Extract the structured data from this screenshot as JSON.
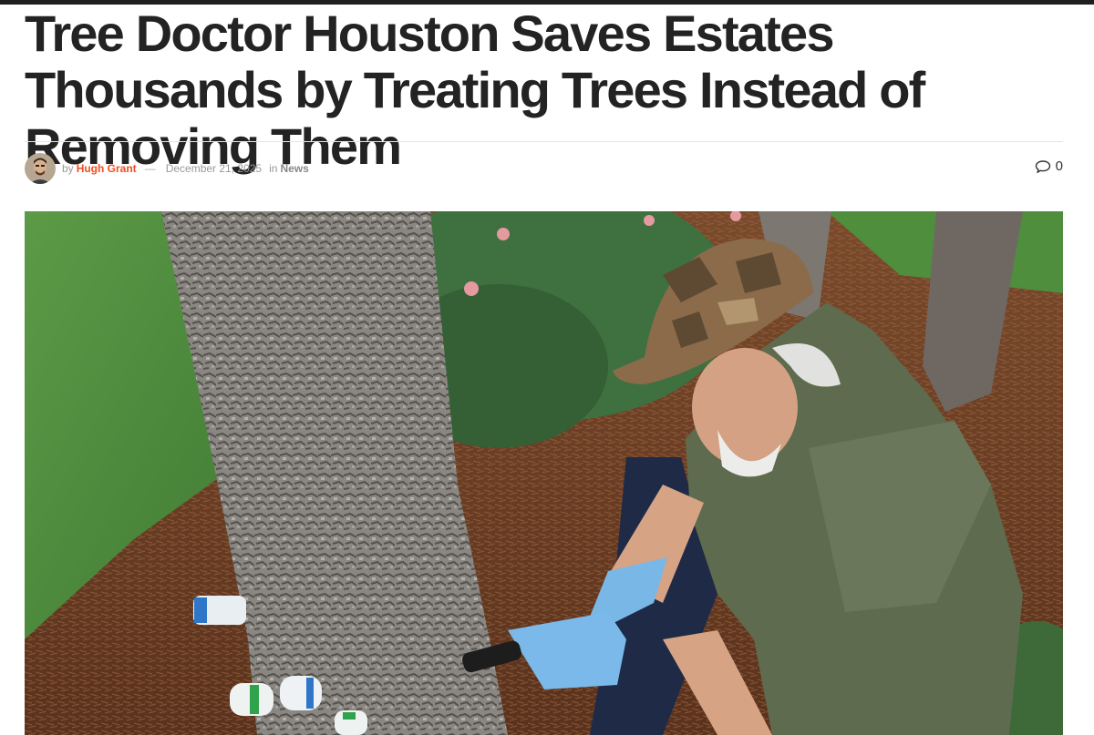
{
  "article": {
    "title": "Tree Doctor Houston Saves Estates Thousands by Treating Trees Instead of Removing Them",
    "meta": {
      "by_prefix": "by",
      "author": "Hugh Grant",
      "separator": "—",
      "date": "December 21, 2025",
      "in_prefix": "in",
      "category": "News"
    },
    "comment_count": "0"
  },
  "colors": {
    "accent": "#f04e23",
    "title": "#232323",
    "meta": "#999999"
  },
  "icons": {
    "comment": "comment-bubble-icon",
    "avatar": "author-avatar"
  }
}
